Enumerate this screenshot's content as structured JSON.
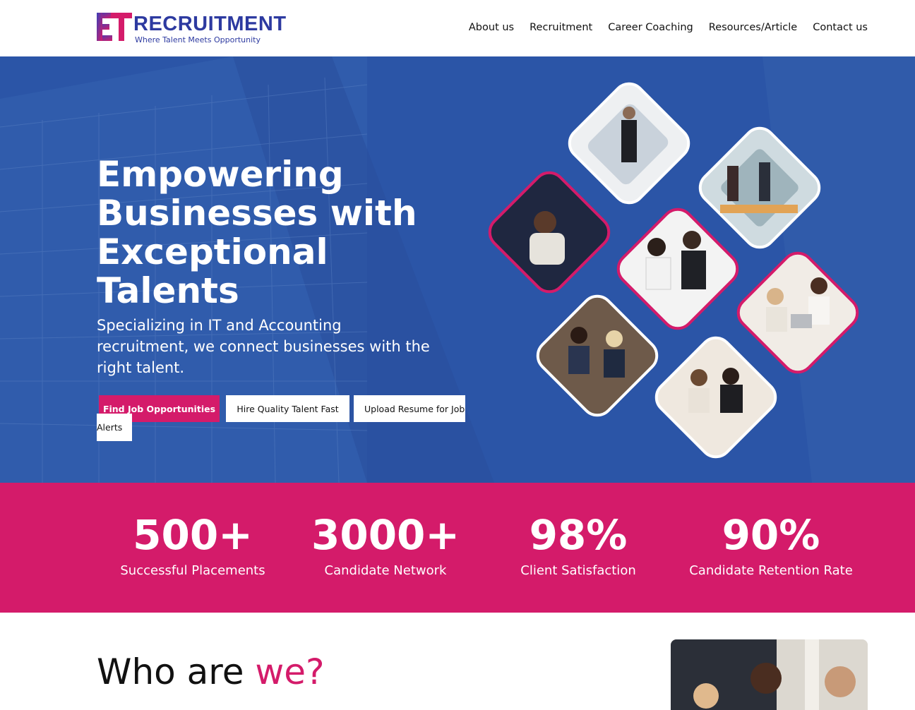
{
  "brand": {
    "name": "RECRUITMENT",
    "tagline": "Where Talent Meets Opportunity",
    "colors": {
      "primary_blue": "#2d3aa0",
      "hero_blue": "#2b55a7",
      "accent_pink": "#d41b6a"
    }
  },
  "nav": {
    "items": [
      {
        "label": "About us"
      },
      {
        "label": "Recruitment"
      },
      {
        "label": "Career Coaching"
      },
      {
        "label": "Resources/Article"
      },
      {
        "label": "Contact us"
      }
    ]
  },
  "hero": {
    "title": "Empowering Businesses with Exceptional Talents",
    "subtitle": "Specializing in IT and Accounting recruitment, we connect businesses with the right talent.",
    "buttons": {
      "find_jobs": "Find Job Opportunities",
      "hire_talent": "Hire Quality Talent Fast",
      "upload_resume_line1": "Upload Resume for Job",
      "upload_resume_line2": "Alerts"
    }
  },
  "stats": [
    {
      "value": "500+",
      "label": "Successful Placements"
    },
    {
      "value": "3000+",
      "label": "Candidate Network"
    },
    {
      "value": "98%",
      "label": "Client Satisfaction"
    },
    {
      "value": "90%",
      "label": "Candidate Retention Rate"
    }
  ],
  "who": {
    "title_part1": "Who are ",
    "title_part2": "we?"
  }
}
